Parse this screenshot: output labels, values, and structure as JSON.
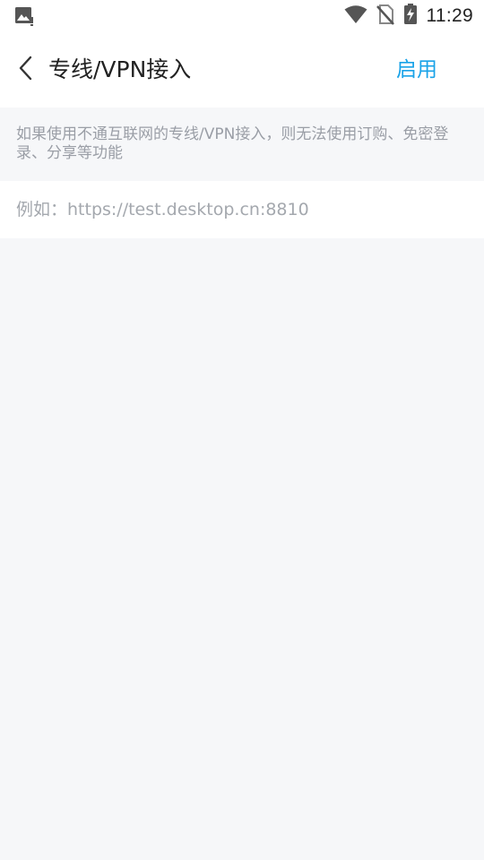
{
  "status_bar": {
    "time": "11:29",
    "icons": [
      "gallery-notification-icon",
      "wifi-icon",
      "no-sim-icon",
      "battery-charging-icon"
    ]
  },
  "header": {
    "title": "专线/VPN接入",
    "back_icon": "chevron-left-icon",
    "action_label": "启用"
  },
  "notice": {
    "text": "如果使用不通互联网的专线/VPN接入，则无法使用订购、免密登录、分享等功能"
  },
  "url_input": {
    "value": "",
    "placeholder": "例如：https://test.desktop.cn:8810"
  },
  "colors": {
    "accent": "#1aa3e8",
    "background": "#f6f7f9",
    "surface": "#ffffff",
    "muted_text": "#9a9ea6"
  }
}
